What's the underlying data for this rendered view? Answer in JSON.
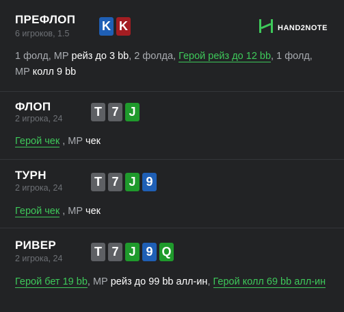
{
  "logo": {
    "text": "HAND2NOTE"
  },
  "preflop": {
    "title": "ПРЕФЛОП",
    "subtitle": "6 игроков, 1.5",
    "cards": [
      "K",
      "K"
    ],
    "line": {
      "p1": "1 фолд, МР ",
      "a1": "рейз до 3 bb",
      "p2": ", 2 фолда, ",
      "h1": "Герой рейз до 12 bb",
      "p3": ", 1 фолд, МР ",
      "a2": "колл 9 bb"
    }
  },
  "flop": {
    "title": "ФЛОП",
    "subtitle": "2 игрока, 24",
    "cards": [
      "T",
      "7",
      "J"
    ],
    "line": {
      "h1": "Герой чек",
      "p1": " , МР ",
      "a1": "чек"
    }
  },
  "turn": {
    "title": "ТУРН",
    "subtitle": "2 игрока, 24",
    "cards": [
      "T",
      "7",
      "J",
      "9"
    ],
    "line": {
      "h1": "Герой чек",
      "p1": " , МР ",
      "a1": "чек"
    }
  },
  "river": {
    "title": "РИВЕР",
    "subtitle": "2 игрока, 24",
    "cards": [
      "T",
      "7",
      "J",
      "9",
      "Q"
    ],
    "line": {
      "h1": "Герой бет 19 bb",
      "p1": ", МР ",
      "a1": "рейз до 99 bb алл-ин",
      "p2": ", ",
      "h2": "Герой колл 69 bb алл-ин"
    }
  },
  "colors": {
    "card_spade": "#5e6064",
    "card_club": "#1f9a2c",
    "card_diamond": "#1f5fb5",
    "card_heart": "#a31d22",
    "hero_text": "#3ec95a"
  }
}
